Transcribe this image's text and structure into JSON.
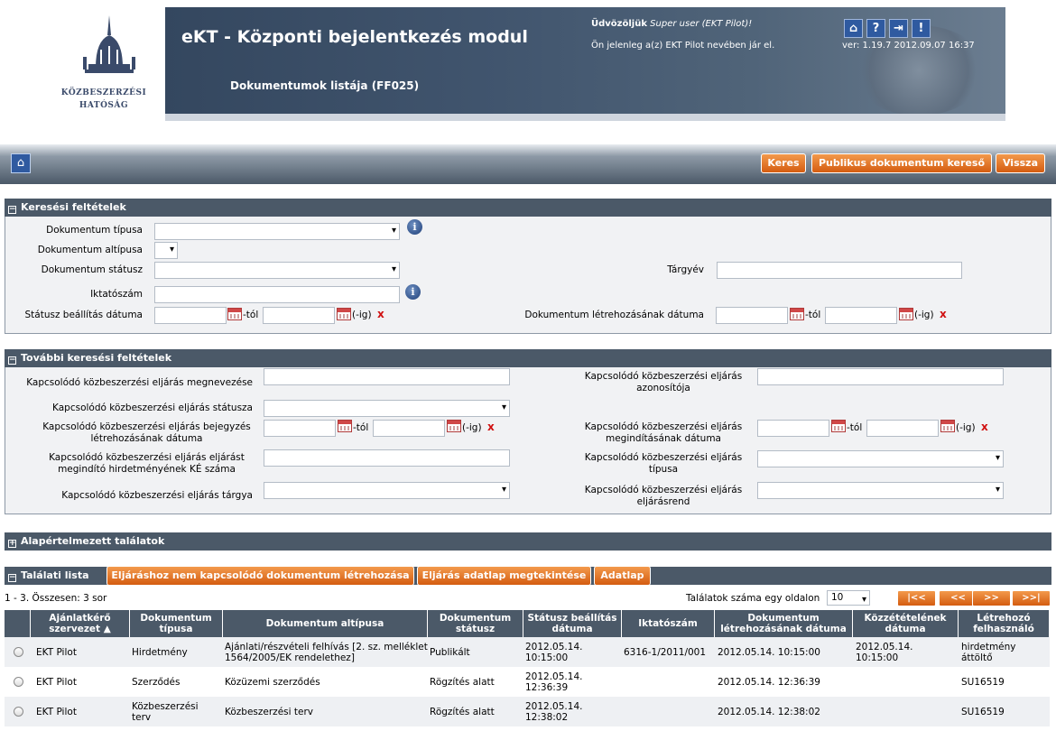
{
  "header": {
    "logo_line1": "Közbeszerzési",
    "logo_line2": "Hatóság",
    "app_title": "eKT - Központi bejelentkezés modul",
    "page_subtitle": "Dokumentumok listája (FF025)",
    "welcome_prefix": "Üdvözöljük",
    "welcome_user": "Super user (EKT Pilot)!",
    "acting_as": "Ön jelenleg a(z) EKT Pilot nevében jár el.",
    "version": "ver: 1.19.7 2012.09.07 16:37",
    "icons": [
      "home-icon",
      "help-icon",
      "logout-icon",
      "alert-icon"
    ]
  },
  "toolbar": {
    "search_label": "Keres",
    "public_search_label": "Publikus dokumentum kereső",
    "back_label": "Vissza"
  },
  "search_panel": {
    "title": "Keresési feltételek",
    "doc_type_label": "Dokumentum típusa",
    "doc_subtype_label": "Dokumentum altípusa",
    "doc_status_label": "Dokumentum státusz",
    "subject_year_label": "Tárgyév",
    "filing_number_label": "Iktatószám",
    "status_date_label": "Státusz beállítás dátuma",
    "created_date_label": "Dokumentum létrehozásának dátuma",
    "from_suffix": "-tól",
    "to_suffix": "(-ig)",
    "clear_mark": "x"
  },
  "more_panel": {
    "title": "További keresési feltételek",
    "proc_name_label": "Kapcsolódó közbeszerzési eljárás megnevezése",
    "proc_id_label": "Kapcsolódó közbeszerzési eljárás azonosítója",
    "proc_status_label": "Kapcsolódó közbeszerzési eljárás státusza",
    "proc_reg_date_label": "Kapcsolódó közbeszerzési eljárás bejegyzés létrehozásának dátuma",
    "proc_start_date_label": "Kapcsolódó közbeszerzési eljárás megindításának dátuma",
    "proc_notice_label": "Kapcsolódó közbeszerzési eljárás eljárást megindító hirdetményének KÉ száma",
    "proc_type_label": "Kapcsolódó közbeszerzési eljárás típusa",
    "proc_subject_label": "Kapcsolódó közbeszerzési eljárás tárgya",
    "proc_regime_label": "Kapcsolódó közbeszerzési eljárás eljárásrend"
  },
  "defaults_panel": {
    "title": "Alapértelmezett találatok"
  },
  "results": {
    "title": "Találati lista",
    "btn_create": "Eljáráshoz nem kapcsolódó dokumentum létrehozása",
    "btn_view_proc": "Eljárás adatlap megtekintése",
    "btn_datasheet": "Adatlap",
    "summary": "1 - 3. Összesen: 3 sor",
    "per_page_label": "Találatok száma egy oldalon",
    "per_page_value": "10",
    "pager": [
      "|<<",
      "<<",
      ">>",
      ">>|"
    ],
    "columns": [
      "Ajánlatkérő szervezet ▲",
      "Dokumentum típusa",
      "Dokumentum altípusa",
      "Dokumentum státusz",
      "Státusz beállítás dátuma",
      "Iktatószám",
      "Dokumentum létrehozásának dátuma",
      "Közzétételének dátuma",
      "Létrehozó felhasználó"
    ],
    "rows": [
      {
        "org": "EKT Pilot",
        "type": "Hirdetmény",
        "subtype": "Ajánlati/részvételi felhívás [2. sz. melléklet 1564/2005/EK rendelethez]",
        "status": "Publikált",
        "status_date": "2012.05.14. 10:15:00",
        "filing_no": "6316-1/2011/001",
        "created": "2012.05.14. 10:15:00",
        "published": "2012.05.14. 10:15:00",
        "creator": "hirdetmény áttöltő"
      },
      {
        "org": "EKT Pilot",
        "type": "Szerződés",
        "subtype": "Közüzemi szerződés",
        "status": "Rögzítés alatt",
        "status_date": "2012.05.14. 12:36:39",
        "filing_no": "",
        "created": "2012.05.14. 12:36:39",
        "published": "",
        "creator": "SU16519"
      },
      {
        "org": "EKT Pilot",
        "type": "Közbeszerzési terv",
        "subtype": "Közbeszerzési terv",
        "status": "Rögzítés alatt",
        "status_date": "2012.05.14. 12:38:02",
        "filing_no": "",
        "created": "2012.05.14. 12:38:02",
        "published": "",
        "creator": "SU16519"
      }
    ]
  }
}
